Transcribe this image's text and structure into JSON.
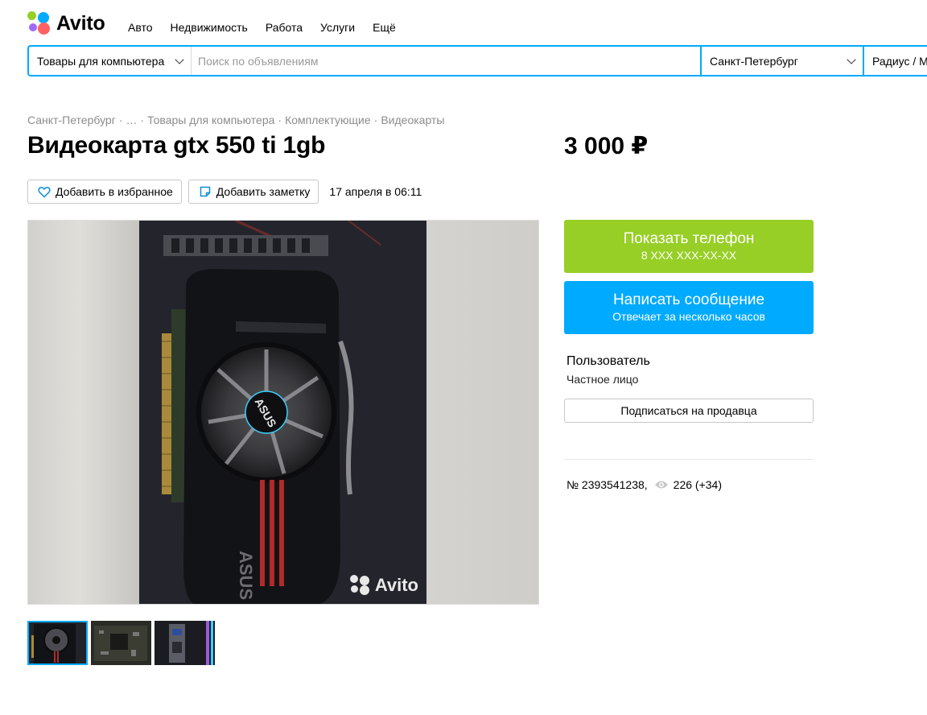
{
  "header": {
    "logo_text": "Avito",
    "nav": [
      "Авто",
      "Недвижимость",
      "Работа",
      "Услуги",
      "Ещё"
    ]
  },
  "search": {
    "category": "Товары для компьютера",
    "placeholder": "Поиск по объявлениям",
    "city": "Санкт-Петербург",
    "radius": "Радиус / Метро"
  },
  "breadcrumb": [
    "Санкт-Петербург",
    "…",
    "Товары для компьютера",
    "Комплектующие",
    "Видеокарты"
  ],
  "listing": {
    "title": "Видеокарта gtx 550 ti 1gb",
    "price": "3 000 ₽",
    "favorite_label": "Добавить в избранное",
    "note_label": "Добавить заметку",
    "date": "17 апреля в 06:11",
    "watermark": "Avito",
    "number": "№ 2393541238,",
    "views": "226 (+34)"
  },
  "contact": {
    "phone_label": "Показать телефон",
    "phone_masked": "8 XXX XXX-XX-XX",
    "message_label": "Написать сообщение",
    "message_sub": "Отвечает за несколько часов",
    "seller_name": "Пользователь",
    "seller_type": "Частное лицо",
    "subscribe_label": "Подписаться на продавца"
  },
  "colors": {
    "accent_blue": "#00aaff",
    "accent_green": "#97cf26"
  }
}
